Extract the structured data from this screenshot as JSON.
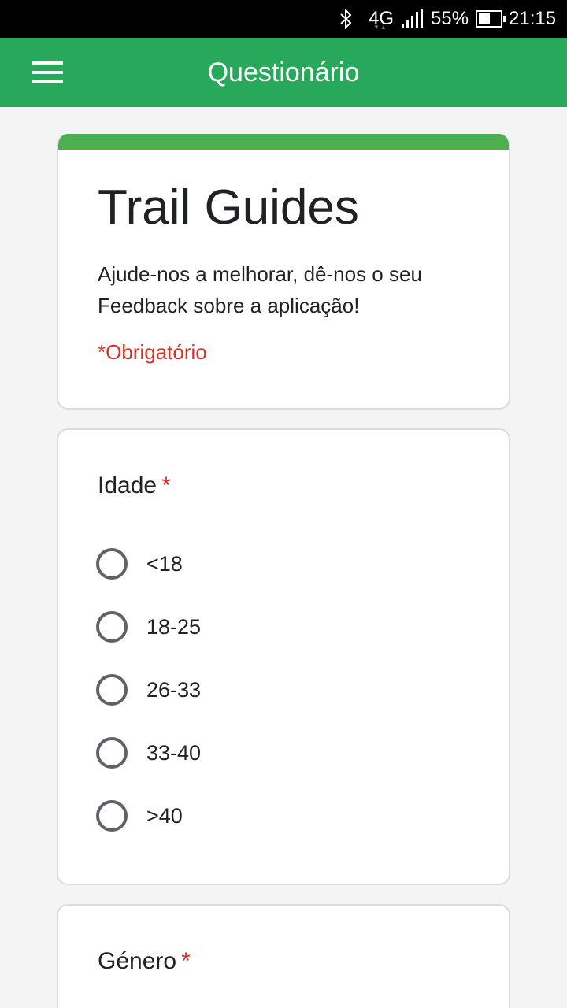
{
  "status_bar": {
    "bluetooth_icon": "bluetooth-icon",
    "network": "4G",
    "battery_percent": "55%",
    "battery_level": 0.55,
    "time": "21:15"
  },
  "app_bar": {
    "menu_icon": "hamburger-menu-icon",
    "title": "Questionário",
    "color": "#27a85a"
  },
  "form": {
    "accent_color": "#4caf50",
    "title": "Trail Guides",
    "description": "Ajude-nos a melhorar, dê-nos o seu Feedback sobre a aplicação!",
    "required_note": "*Obrigatório"
  },
  "questions": [
    {
      "title": "Idade",
      "required_mark": "*",
      "options": [
        "<18",
        "18-25",
        "26-33",
        "33-40",
        ">40"
      ]
    },
    {
      "title": "Género",
      "required_mark": "*",
      "options": []
    }
  ]
}
